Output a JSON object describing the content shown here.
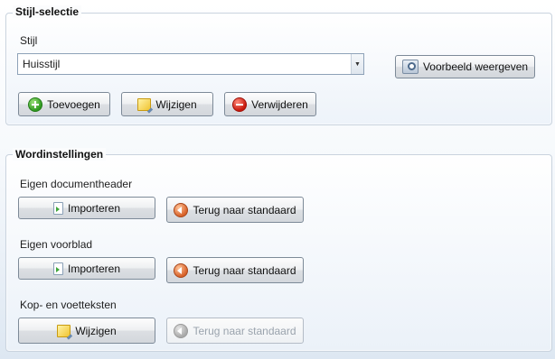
{
  "stijl_selectie": {
    "title": "Stijl-selectie",
    "stijl_label": "Stijl",
    "stijl_value": "Huisstijl",
    "preview_button": "Voorbeeld weergeven",
    "add_button": "Toevoegen",
    "edit_button": "Wijzigen",
    "delete_button": "Verwijderen"
  },
  "wordinstellingen": {
    "title": "Wordinstellingen",
    "documentheader": {
      "label": "Eigen documentheader",
      "import_button": "Importeren",
      "reset_button": "Terug naar standaard"
    },
    "voorblad": {
      "label": "Eigen voorblad",
      "import_button": "Importeren",
      "reset_button": "Terug naar standaard"
    },
    "kop_voet": {
      "label": "Kop- en voetteksten",
      "edit_button": "Wijzigen",
      "reset_button": "Terug naar standaard",
      "reset_enabled": false
    }
  },
  "icons": {
    "add": "plus-icon",
    "edit": "edit-icon",
    "delete": "delete-icon",
    "preview": "preview-search-icon",
    "import": "import-icon",
    "reset": "back-arrow-icon"
  }
}
